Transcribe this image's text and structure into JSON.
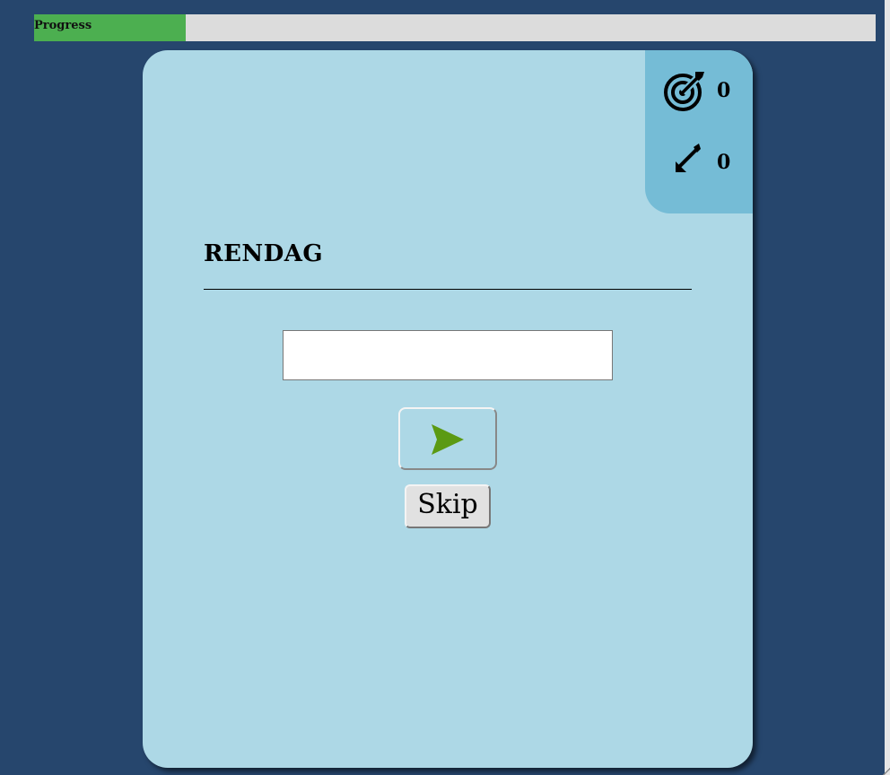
{
  "progress": {
    "label": "Progress",
    "fraction": 0.18
  },
  "scores": {
    "hits_icon": "target-icon",
    "hits": "0",
    "misses_icon": "miss-arrow-icon",
    "misses": "0"
  },
  "question": {
    "word": "RENDAG"
  },
  "answer": {
    "value": "",
    "placeholder": ""
  },
  "controls": {
    "submit_icon": "send-icon",
    "skip_label": "Skip"
  },
  "colors": {
    "background": "#26466d",
    "card": "#add8e6",
    "score_panel": "#75bcd6",
    "progress_fill": "#4caf50",
    "progress_track": "#dcdcdc",
    "send_icon": "#5b9a13"
  }
}
